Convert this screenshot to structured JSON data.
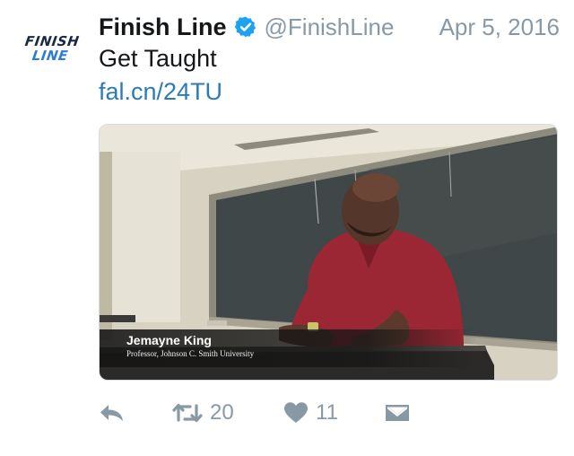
{
  "author": {
    "name": "Finish Line",
    "handle": "@FinishLine",
    "logo_line1": "FINISH",
    "logo_line2": "LINE",
    "verified_icon": "verified-badge-icon"
  },
  "tweet": {
    "date": "Apr 5, 2016",
    "text": "Get Taught",
    "link": "fal.cn/24TU"
  },
  "media": {
    "type": "video-still",
    "caption_name": "Jemayne King",
    "caption_title": "Professor, Johnson C. Smith University"
  },
  "actions": {
    "reply_icon": "reply-icon",
    "retweet_icon": "retweet-icon",
    "retweet_count": "20",
    "like_icon": "heart-icon",
    "like_count": "11",
    "dm_icon": "direct-message-icon"
  },
  "colors": {
    "name_text": "#14171a",
    "secondary_text": "#8899a6",
    "link": "#2b7bb9",
    "verified_badge": "#1da1f2",
    "action_icons": "#8899a6"
  }
}
